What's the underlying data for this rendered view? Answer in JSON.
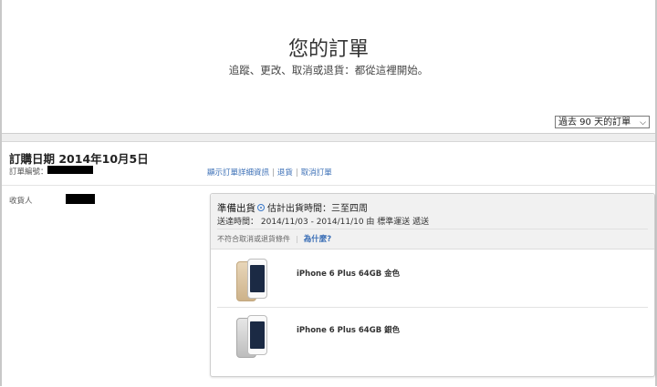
{
  "header": {
    "title": "您的訂單",
    "subtitle": "追蹤、更改、取消或退貨：都從這裡開始。",
    "period_select": "過去 90 天的訂單"
  },
  "order": {
    "date_label": "訂購日期 2014年10月5日",
    "order_number_label": "訂單編號：",
    "links": {
      "details": "顯示訂單詳細資訊",
      "return": "退貨",
      "cancel": "取消訂單"
    },
    "recipient_label": "收貨人",
    "shipment": {
      "status": "準備出貨",
      "estimate": "估計出貨時間：三至四周",
      "delivery": "送達時間：  2014/11/03 - 2014/11/10 由 標準運送 遞送",
      "no_cancel_note": "不符合取消或退貨條件",
      "why_link": "為什麼?"
    },
    "items": [
      {
        "name": "iPhone 6 Plus 64GB 金色",
        "color": "#d8c29e"
      },
      {
        "name": "iPhone 6 Plus 64GB 銀色",
        "color": "#d2d2d2"
      }
    ]
  },
  "colors": {
    "link": "#3b6fb6",
    "panel_gray": "#f1f1f1",
    "background_gap": "#eeeeee"
  }
}
